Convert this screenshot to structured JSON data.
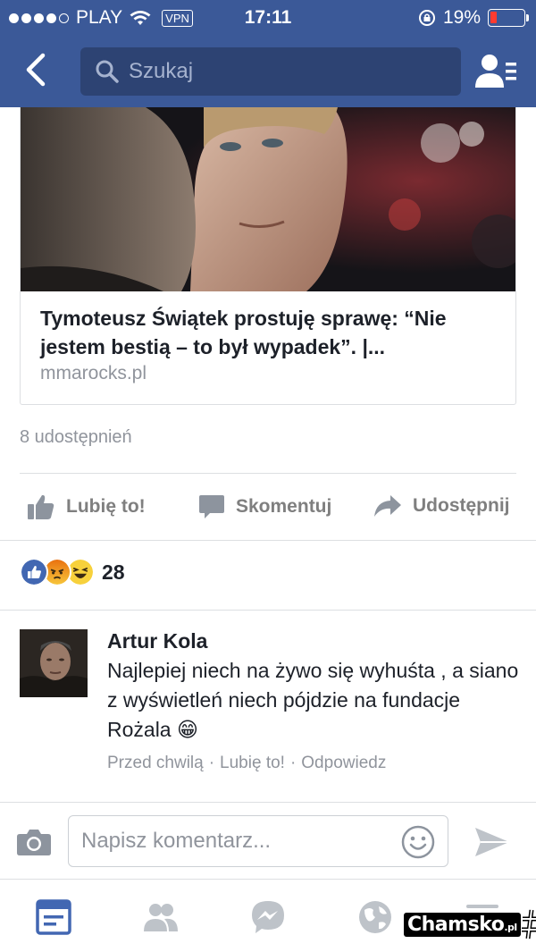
{
  "status_bar": {
    "carrier": "PLAY",
    "vpn": "VPN",
    "time": "17:11",
    "battery": "19%",
    "battery_level": 0.19,
    "signal_bars_filled": 4,
    "signal_bars_total": 5
  },
  "header": {
    "search_placeholder": "Szukaj",
    "icons": [
      "back-chevron-icon",
      "search-icon",
      "friend-requests-icon"
    ]
  },
  "link_card": {
    "title": "Tymoteusz Świątek prostuję sprawę: “Nie jestem bestią – to był wypadek”. |...",
    "domain": "mmarocks.pl"
  },
  "post": {
    "shares": "8 udostępnień"
  },
  "actions": {
    "like": "Lubię to!",
    "comment": "Skomentuj",
    "share": "Udostępnij"
  },
  "reactions": {
    "types": [
      "like",
      "angry",
      "haha"
    ],
    "count": "28"
  },
  "comment": {
    "author": "Artur Kola",
    "text": "Najlepiej niech na żywo się wyhuśta , a siano z wyświetleń niech pójdzie na fundacje Rożala 😁",
    "time": "Przed chwilą",
    "like": "Lubię to!",
    "reply": "Odpowiedz"
  },
  "composer": {
    "placeholder": "Napisz komentarz..."
  },
  "tabs": [
    "news-feed",
    "friends",
    "messenger",
    "notifications",
    "more"
  ],
  "watermark": {
    "text": "Chamsko",
    "suffix": ".pl"
  },
  "colors": {
    "brand": "#3b5998",
    "secondary_text": "#90949c",
    "action_text": "#7f7f7f",
    "like_blue": "#4267b2"
  }
}
